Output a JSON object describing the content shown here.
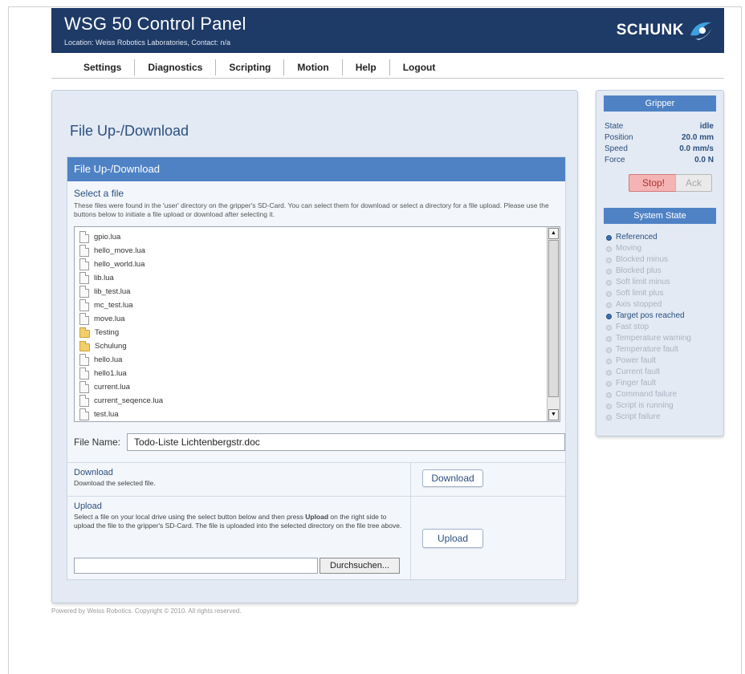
{
  "header": {
    "title": "WSG 50 Control Panel",
    "subtitle": "Location: Weiss Robotics Laboratories, Contact: n/a",
    "brand": "SCHUNK"
  },
  "nav": {
    "items": [
      {
        "label": "Settings"
      },
      {
        "label": "Diagnostics"
      },
      {
        "label": "Scripting"
      },
      {
        "label": "Motion"
      },
      {
        "label": "Help"
      },
      {
        "label": "Logout"
      }
    ]
  },
  "main": {
    "heading": "File Up-/Download",
    "box_title": "File Up-/Download",
    "select_title": "Select a file",
    "select_desc": "These files were found in the 'user' directory on the gripper's SD-Card. You can select them for download or select a directory for a file upload. Please use the buttons below to initiate a file upload or download after selecting it.",
    "files": [
      {
        "name": "gpio.lua",
        "type": "file"
      },
      {
        "name": "hello_move.lua",
        "type": "file"
      },
      {
        "name": "hello_world.lua",
        "type": "file"
      },
      {
        "name": "lib.lua",
        "type": "file"
      },
      {
        "name": "lib_test.lua",
        "type": "file"
      },
      {
        "name": "mc_test.lua",
        "type": "file"
      },
      {
        "name": "move.lua",
        "type": "file"
      },
      {
        "name": "Testing",
        "type": "folder"
      },
      {
        "name": "Schulung",
        "type": "folder"
      },
      {
        "name": "hello.lua",
        "type": "file"
      },
      {
        "name": "hello1.lua",
        "type": "file"
      },
      {
        "name": "current.lua",
        "type": "file"
      },
      {
        "name": "current_seqence.lua",
        "type": "file"
      },
      {
        "name": "test.lua",
        "type": "file"
      }
    ],
    "filename_label": "File Name:",
    "filename_value": "Todo-Liste Lichtenbergstr.doc",
    "download": {
      "title": "Download",
      "desc": "Download the selected file.",
      "button": "Download"
    },
    "upload": {
      "title": "Upload",
      "desc_pre": "Select a file on your local drive using the select button below and then press ",
      "desc_bold": "Upload",
      "desc_post": " on the right side to upload the file to the gripper's SD-Card. The file is uploaded into the selected directory on the file tree above.",
      "button": "Upload",
      "browse_button": "Durchsuchen..."
    }
  },
  "footer": {
    "text": "Powered by Weiss Robotics. Copyright © 2010. All rights reserved."
  },
  "gripper": {
    "title": "Gripper",
    "stats": [
      {
        "label": "State",
        "value": "idle"
      },
      {
        "label": "Position",
        "value": "20.0 mm"
      },
      {
        "label": "Speed",
        "value": "0.0 mm/s"
      },
      {
        "label": "Force",
        "value": "0.0 N"
      }
    ],
    "stop_label": "Stop!",
    "ack_label": "Ack"
  },
  "system_state": {
    "title": "System State",
    "items": [
      {
        "label": "Referenced",
        "active": true
      },
      {
        "label": "Moving",
        "active": false
      },
      {
        "label": "Blocked minus",
        "active": false
      },
      {
        "label": "Blocked plus",
        "active": false
      },
      {
        "label": "Soft limit minus",
        "active": false
      },
      {
        "label": "Soft limit plus",
        "active": false
      },
      {
        "label": "Axis stopped",
        "active": false
      },
      {
        "label": "Target pos reached",
        "active": true
      },
      {
        "label": "Fast stop",
        "active": false
      },
      {
        "label": "Temperature warning",
        "active": false
      },
      {
        "label": "Temperature fault",
        "active": false
      },
      {
        "label": "Power fault",
        "active": false
      },
      {
        "label": "Current fault",
        "active": false
      },
      {
        "label": "Finger fault",
        "active": false
      },
      {
        "label": "Command failure",
        "active": false
      },
      {
        "label": "Script is running",
        "active": false
      },
      {
        "label": "Script failure",
        "active": false
      }
    ]
  },
  "colors": {
    "header_bg": "#1e3a66",
    "accent": "#4f82c5",
    "panel_bg": "#e3eaf3",
    "heading": "#2b4f80",
    "active_dot": "#3a6fb5",
    "stop_bg": "#f4b4b4"
  },
  "icons": {
    "file": "file-icon",
    "folder": "folder-icon",
    "state_dot": "status-dot-icon",
    "brand_logo": "schunk-logo-icon"
  }
}
